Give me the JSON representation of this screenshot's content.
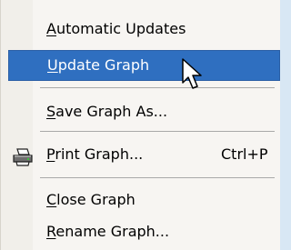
{
  "menu": {
    "items": [
      {
        "key": "automatic_updates",
        "accel": "A",
        "rest": "utomatic Updates"
      },
      {
        "key": "update_graph",
        "accel": "U",
        "rest": "pdate Graph"
      },
      {
        "key": "save_graph_as",
        "accel": "S",
        "rest": "ave Graph As..."
      },
      {
        "key": "print_graph",
        "accel": "P",
        "rest": "rint Graph...",
        "shortcut": "Ctrl+P",
        "icon": "printer-icon"
      },
      {
        "key": "close_graph",
        "accel": "C",
        "rest": "lose Graph"
      },
      {
        "key": "rename_graph",
        "accel": "R",
        "rest": "ename Graph..."
      }
    ]
  },
  "colors": {
    "highlight": "#2f6fc0",
    "menu_background": "#f7f5f2",
    "page_background": "#d8e7f4"
  }
}
